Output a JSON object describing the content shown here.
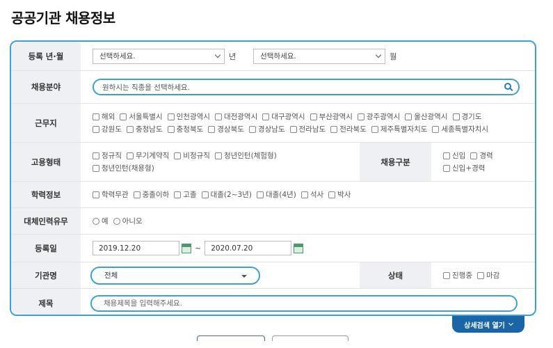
{
  "page_title": "공공기관 채용정보",
  "reg_month": {
    "label": "등록 년·월",
    "year_select": "선택하세요.",
    "year_unit": "년",
    "month_select": "선택하세요.",
    "month_unit": "월"
  },
  "field": {
    "label": "채용분야",
    "placeholder": "원하시는 직종을 선택하세요."
  },
  "location": {
    "label": "근무지",
    "options": [
      "해외",
      "서울특별시",
      "인천광역시",
      "대전광역시",
      "대구광역시",
      "부산광역시",
      "광주광역시",
      "울산광역시",
      "경기도",
      "강원도",
      "충청남도",
      "충청북도",
      "경상북도",
      "경상남도",
      "전라남도",
      "전라북도",
      "제주특별자치도",
      "세종특별자치시"
    ]
  },
  "employment_type": {
    "label": "고용형태",
    "options": [
      "정규직",
      "무기계약직",
      "비정규직",
      "청년인턴(체험형)",
      "청년인턴(채용형)"
    ]
  },
  "recruit_type": {
    "label": "채용구분",
    "options": [
      "신입",
      "경력",
      "신입+경력"
    ]
  },
  "education": {
    "label": "학력정보",
    "options": [
      "학력무관",
      "중졸이하",
      "고졸",
      "대졸(2~3년)",
      "대졸(4년)",
      "석사",
      "박사"
    ]
  },
  "substitute": {
    "label": "대체인력유무",
    "options": [
      "예",
      "아니오"
    ]
  },
  "reg_date": {
    "label": "등록일",
    "start": "2019.12.20",
    "separator": "~",
    "end": "2020.07.20"
  },
  "agency": {
    "label": "기관명",
    "value": "전체"
  },
  "status": {
    "label": "상태",
    "options": [
      "진행중",
      "마감"
    ]
  },
  "subject": {
    "label": "제목",
    "placeholder": "채용제목을 입력해주세요."
  },
  "detail_search_label": "상세검색 열기",
  "colors": {
    "accent": "#3aa0d8",
    "button": "#1a65a8",
    "header_bg": "#eef0f3"
  }
}
